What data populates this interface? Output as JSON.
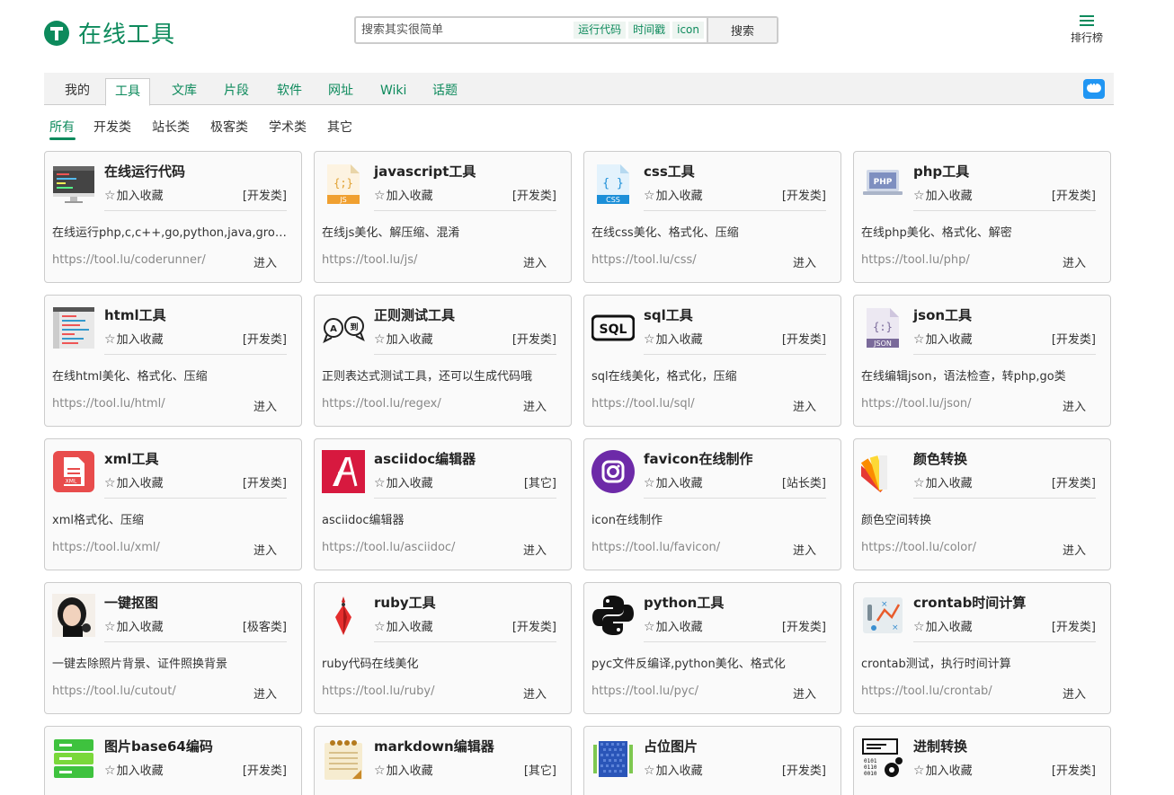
{
  "header": {
    "logo_text": "在线工具",
    "search": {
      "placeholder": "搜索其实很简单",
      "quick_tags": [
        "运行代码",
        "时间戳",
        "icon"
      ],
      "button": "搜索"
    },
    "rank_label": "排行榜"
  },
  "nav": {
    "tabs": [
      "我的",
      "工具",
      "文库",
      "片段",
      "软件",
      "网址",
      "Wiki",
      "话题"
    ],
    "active": "工具"
  },
  "subnav": {
    "tabs": [
      "所有",
      "开发类",
      "站长类",
      "极客类",
      "学术类",
      "其它"
    ],
    "active": "所有"
  },
  "fav_label": "加入收藏",
  "enter_label": "进入",
  "cards": [
    {
      "title": "在线运行代码",
      "category": "[开发类]",
      "desc": "在线运行php,c,c++,go,python,java,groovy,ruby...",
      "url": "https://tool.lu/coderunner/",
      "icon": "monitor-code-icon"
    },
    {
      "title": "javascript工具",
      "category": "[开发类]",
      "desc": "在线js美化、解压缩、混淆",
      "url": "https://tool.lu/js/",
      "icon": "js-file-icon"
    },
    {
      "title": "css工具",
      "category": "[开发类]",
      "desc": "在线css美化、格式化、压缩",
      "url": "https://tool.lu/css/",
      "icon": "css-file-icon"
    },
    {
      "title": "php工具",
      "category": "[开发类]",
      "desc": "在线php美化、格式化、解密",
      "url": "https://tool.lu/php/",
      "icon": "php-laptop-icon"
    },
    {
      "title": "html工具",
      "category": "[开发类]",
      "desc": "在线html美化、格式化、压缩",
      "url": "https://tool.lu/html/",
      "icon": "html-editor-icon"
    },
    {
      "title": "正则测试工具",
      "category": "[开发类]",
      "desc": "正则表达式测试工具，还可以生成代码哦",
      "url": "https://tool.lu/regex/",
      "icon": "regex-bubbles-icon"
    },
    {
      "title": "sql工具",
      "category": "[开发类]",
      "desc": "sql在线美化，格式化，压缩",
      "url": "https://tool.lu/sql/",
      "icon": "sql-badge-icon"
    },
    {
      "title": "json工具",
      "category": "[开发类]",
      "desc": "在线编辑json，语法检查，转php,go类",
      "url": "https://tool.lu/json/",
      "icon": "json-file-icon"
    },
    {
      "title": "xml工具",
      "category": "[开发类]",
      "desc": "xml格式化、压缩",
      "url": "https://tool.lu/xml/",
      "icon": "xml-file-icon"
    },
    {
      "title": "asciidoc编辑器",
      "category": "[其它]",
      "desc": "asciidoc编辑器",
      "url": "https://tool.lu/asciidoc/",
      "icon": "asciidoc-logo-icon"
    },
    {
      "title": "favicon在线制作",
      "category": "[站长类]",
      "desc": "icon在线制作",
      "url": "https://tool.lu/favicon/",
      "icon": "camera-circle-icon"
    },
    {
      "title": "颜色转换",
      "category": "[开发类]",
      "desc": "颜色空间转换",
      "url": "https://tool.lu/color/",
      "icon": "color-swatch-icon"
    },
    {
      "title": "一键抠图",
      "category": "[极客类]",
      "desc": "一键去除照片背景、证件照换背景",
      "url": "https://tool.lu/cutout/",
      "icon": "portrait-photo-icon"
    },
    {
      "title": "ruby工具",
      "category": "[开发类]",
      "desc": "ruby代码在线美化",
      "url": "https://tool.lu/ruby/",
      "icon": "ruby-gem-icon"
    },
    {
      "title": "python工具",
      "category": "[开发类]",
      "desc": "pyc文件反编译,python美化、格式化",
      "url": "https://tool.lu/pyc/",
      "icon": "python-logo-icon"
    },
    {
      "title": "crontab时间计算",
      "category": "[开发类]",
      "desc": "crontab测试，执行时间计算",
      "url": "https://tool.lu/crontab/",
      "icon": "crontab-chart-icon"
    },
    {
      "title": "图片base64编码",
      "category": "[开发类]",
      "desc": "",
      "url": "",
      "icon": "base64-stack-icon"
    },
    {
      "title": "markdown编辑器",
      "category": "[其它]",
      "desc": "",
      "url": "",
      "icon": "notepad-icon"
    },
    {
      "title": "占位图片",
      "category": "[开发类]",
      "desc": "",
      "url": "",
      "icon": "placeholder-grid-icon"
    },
    {
      "title": "进制转换",
      "category": "[开发类]",
      "desc": "",
      "url": "",
      "icon": "binary-gears-icon"
    }
  ]
}
